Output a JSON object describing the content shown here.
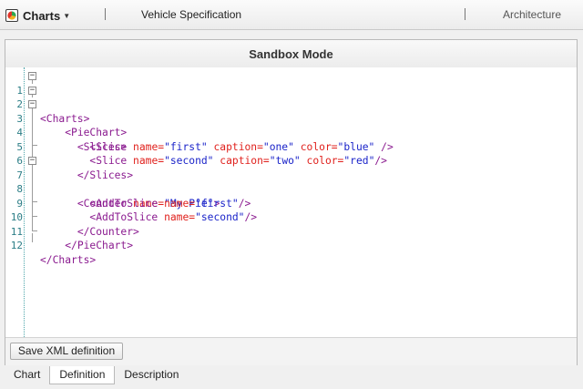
{
  "toolbar": {
    "app_name": "Charts",
    "app_icon": "chart-logo-icon",
    "dropdown_icon": "caret-down-icon",
    "center_title": "Vehicle Specification",
    "right_label": "Architecture"
  },
  "panel": {
    "title": "Sandbox Mode"
  },
  "editor": {
    "lines": [
      {
        "n": "1"
      },
      {
        "n": "2"
      },
      {
        "n": "3"
      },
      {
        "n": "4"
      },
      {
        "n": "5"
      },
      {
        "n": "6"
      },
      {
        "n": "7"
      },
      {
        "n": "8"
      },
      {
        "n": "9"
      },
      {
        "n": "10"
      },
      {
        "n": "11"
      },
      {
        "n": "12"
      }
    ],
    "tokens": {
      "l1_tag": "<Charts>",
      "l2_tag": "<PieChart>",
      "l3_tag": "<Slices>",
      "l4_open": "<Slice",
      "l4_a1": "name=",
      "l4_v1": "\"first\"",
      "l4_a2": "caption=",
      "l4_v2": "\"one\"",
      "l4_a3": "color=",
      "l4_v3": "\"blue\"",
      "l4_close": "/>",
      "l5_open": "<Slice",
      "l5_a1": "name=",
      "l5_v1": "\"second\"",
      "l5_a2": "caption=",
      "l5_v2": "\"two\"",
      "l5_a3": "color=",
      "l5_v3": "\"red\"",
      "l5_close": "/>",
      "l6_tag": "</Slices>",
      "l7_open": "<Counter",
      "l7_a1": "name=",
      "l7_v1": "\"My Pie\"",
      "l7_close": ">",
      "l8_open": "<AddToSlice",
      "l8_a1": "name=",
      "l8_v1": "\"first\"",
      "l8_close": "/>",
      "l9_open": "<AddToSlice",
      "l9_a1": "name=",
      "l9_v1": "\"second\"",
      "l9_close": "/>",
      "l10_tag": "</Counter>",
      "l11_tag": "</PieChart>",
      "l12_tag": "</Charts>"
    },
    "fold_marker": "−"
  },
  "actions": {
    "save_label": "Save XML definition"
  },
  "tabs": [
    {
      "label": "Chart"
    },
    {
      "label": "Definition",
      "active": true
    },
    {
      "label": "Description"
    }
  ],
  "colors": {
    "tag": "#8a1a8f",
    "attribute": "#e0201c",
    "value": "#1a23c9",
    "line_number": "#2b7d86"
  }
}
